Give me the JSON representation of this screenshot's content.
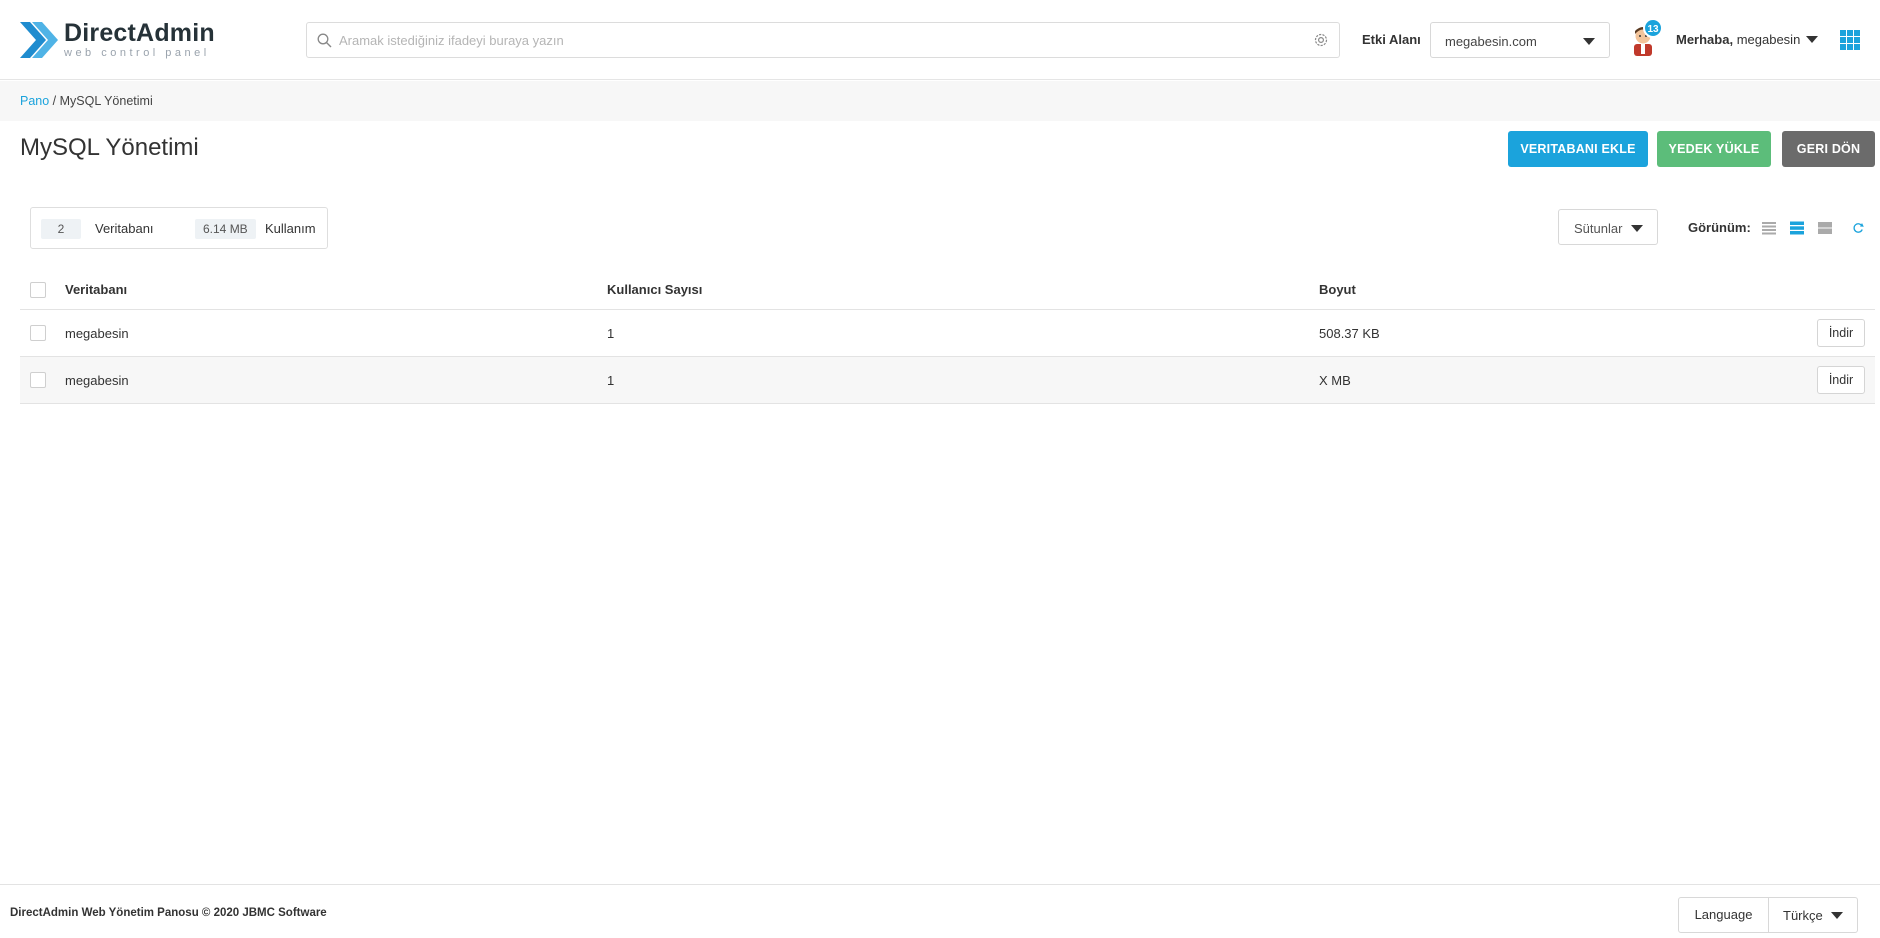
{
  "brand": {
    "name": "DirectAdmin",
    "tagline": "web control panel"
  },
  "header": {
    "search_placeholder": "Aramak istediğiniz ifadeyi buraya yazın",
    "domain_label": "Etki Alanı",
    "domain_value": "megabesin.com",
    "notification_count": "13",
    "greeting_prefix": "Merhaba,",
    "username": "megabesin"
  },
  "breadcrumb": {
    "home": "Pano",
    "separator": " / ",
    "current": "MySQL Yönetimi"
  },
  "page": {
    "title": "MySQL Yönetimi",
    "buttons": {
      "add_db": "VERITABANI EKLE",
      "upload_backup": "YEDEK YÜKLE",
      "back": "GERI DÖN"
    }
  },
  "stats": {
    "db_count": "2",
    "db_label": "Veritabanı",
    "usage": "6.14 MB",
    "usage_label": "Kullanım"
  },
  "toolbar": {
    "columns_label": "Sütunlar",
    "view_label": "Görünüm:"
  },
  "table": {
    "headers": {
      "database": "Veritabanı",
      "users": "Kullanıcı Sayısı",
      "size": "Boyut"
    },
    "rows": [
      {
        "name": "megabesin",
        "users": "1",
        "size": "508.37 KB",
        "action": "İndir"
      },
      {
        "name": "megabesin",
        "users": "1",
        "size": "X MB",
        "action": "İndir"
      }
    ]
  },
  "footer": {
    "copyright": "DirectAdmin Web Yönetim Panosu © 2020 JBMC Software",
    "language_label": "Language",
    "language_value": "Türkçe"
  },
  "colors": {
    "accent": "#1ba3dc",
    "success": "#5cbd7a",
    "neutral": "#6b6b6b",
    "logo_primary": "#1f8ccf"
  }
}
